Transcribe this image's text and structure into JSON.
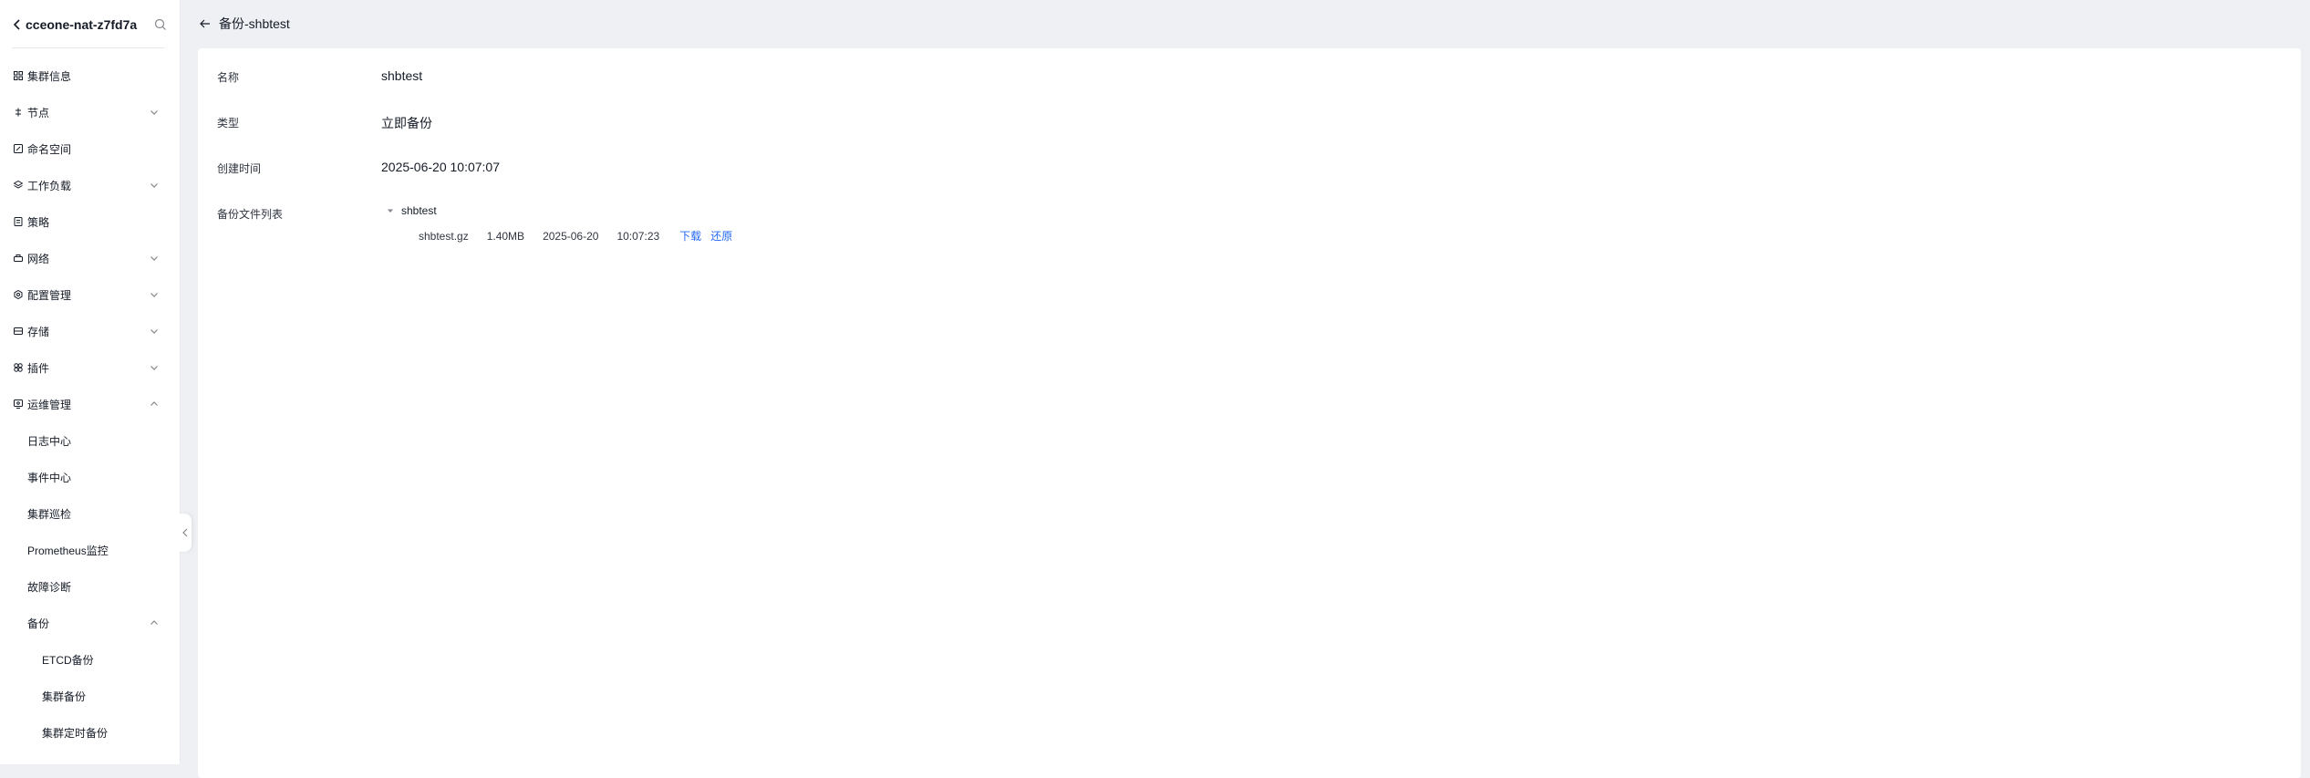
{
  "sidebar": {
    "cluster_name": "cceone-nat-z7fd7a",
    "items": [
      {
        "label": "集群信息",
        "icon": "grid-icon"
      },
      {
        "label": "节点",
        "icon": "node-icon"
      },
      {
        "label": "命名空间",
        "icon": "namespace-icon"
      },
      {
        "label": "工作负载",
        "icon": "workload-icon"
      },
      {
        "label": "策略",
        "icon": "policy-icon"
      },
      {
        "label": "网络",
        "icon": "network-icon"
      },
      {
        "label": "配置管理",
        "icon": "config-icon"
      },
      {
        "label": "存储",
        "icon": "storage-icon"
      },
      {
        "label": "插件",
        "icon": "plugin-icon"
      },
      {
        "label": "运维管理",
        "icon": "ops-icon"
      }
    ],
    "ops_children": [
      "日志中心",
      "事件中心",
      "集群巡检",
      "Prometheus监控",
      "故障诊断",
      "备份"
    ],
    "backup_children": [
      "ETCD备份",
      "集群备份",
      "集群定时备份"
    ]
  },
  "header": {
    "title": "备份-shbtest"
  },
  "detail": {
    "name_label": "名称",
    "name_value": "shbtest",
    "type_label": "类型",
    "type_value": "立即备份",
    "created_label": "创建时间",
    "created_value": "2025-06-20 10:07:07",
    "files_label": "备份文件列表",
    "tree_root": "shbtest",
    "file": {
      "name": "shbtest.gz",
      "size": "1.40MB",
      "date": "2025-06-20",
      "time": "10:07:23",
      "download": "下载",
      "restore": "还原"
    }
  },
  "colors": {
    "link": "#2468f2",
    "background": "#eef0f4",
    "card": "#ffffff"
  }
}
